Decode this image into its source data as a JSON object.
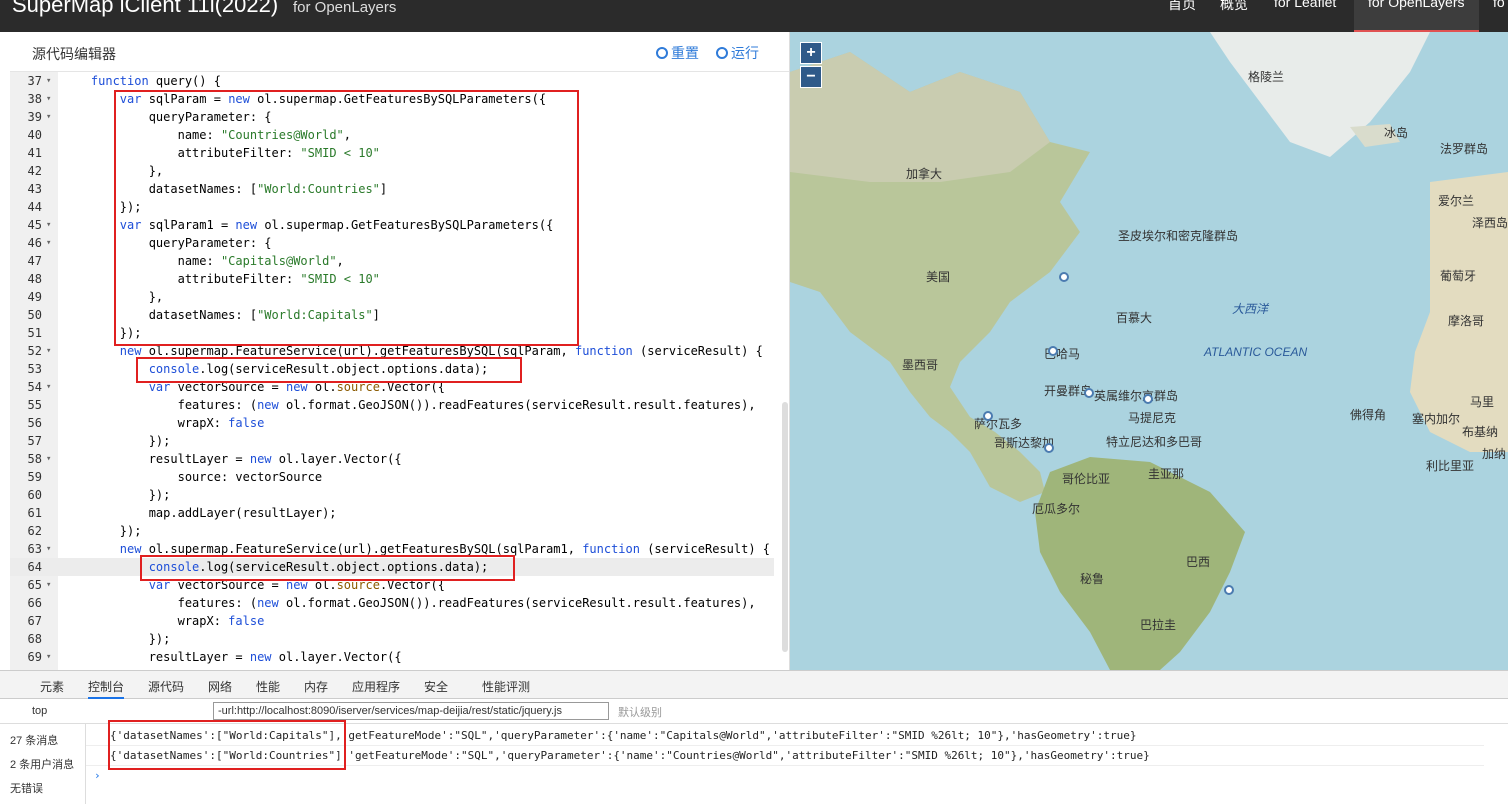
{
  "topbar": {
    "brand": "SuperMap iClient 11i(2022)",
    "subtitle": "for OpenLayers",
    "nav": [
      "首页",
      "概览",
      "for Leaflet",
      "for OpenLayers",
      "fo"
    ]
  },
  "editor": {
    "title": "源代码编辑器",
    "reset_label": "重置",
    "run_label": "运行",
    "lines": [
      {
        "n": "37",
        "fold": true,
        "html": "    <span class='kw'>function</span> query() {"
      },
      {
        "n": "38",
        "fold": true,
        "html": "        <span class='kw'>var</span> sqlParam = <span class='kw'>new</span> ol.supermap.GetFeaturesBySQLParameters({"
      },
      {
        "n": "39",
        "fold": true,
        "html": "            queryParameter: {"
      },
      {
        "n": "40",
        "fold": false,
        "html": "                name: <span class='st'>\"Countries@World\"</span>,"
      },
      {
        "n": "41",
        "fold": false,
        "html": "                attributeFilter: <span class='st'>\"SMID &lt; 10\"</span>"
      },
      {
        "n": "42",
        "fold": false,
        "html": "            },"
      },
      {
        "n": "43",
        "fold": false,
        "html": "            datasetNames: [<span class='st'>\"World:Countries\"</span>]"
      },
      {
        "n": "44",
        "fold": false,
        "html": "        });"
      },
      {
        "n": "45",
        "fold": true,
        "html": "        <span class='kw'>var</span> sqlParam1 = <span class='kw'>new</span> ol.supermap.GetFeaturesBySQLParameters({"
      },
      {
        "n": "46",
        "fold": true,
        "html": "            queryParameter: {"
      },
      {
        "n": "47",
        "fold": false,
        "html": "                name: <span class='st'>\"Capitals@World\"</span>,"
      },
      {
        "n": "48",
        "fold": false,
        "html": "                attributeFilter: <span class='st'>\"SMID &lt; 10\"</span>"
      },
      {
        "n": "49",
        "fold": false,
        "html": "            },"
      },
      {
        "n": "50",
        "fold": false,
        "html": "            datasetNames: [<span class='st'>\"World:Capitals\"</span>]"
      },
      {
        "n": "51",
        "fold": false,
        "html": "        });"
      },
      {
        "n": "52",
        "fold": true,
        "html": "        <span class='kw'>new</span> ol.supermap.FeatureService(url).getFeaturesBySQL(sqlParam, <span class='kw'>function</span> (serviceResult) {"
      },
      {
        "n": "53",
        "fold": false,
        "html": "            <span class='kw'>console</span>.log(serviceResult.object.options.data);"
      },
      {
        "n": "54",
        "fold": true,
        "html": "            <span class='kw'>var</span> vectorSource = <span class='kw'>new</span> ol.<span class='ob'>source</span>.Vector({"
      },
      {
        "n": "55",
        "fold": false,
        "html": "                features: (<span class='kw'>new</span> ol.format.GeoJSON()).readFeatures(serviceResult.result.features),"
      },
      {
        "n": "56",
        "fold": false,
        "html": "                wrapX: <span class='kw'>false</span>"
      },
      {
        "n": "57",
        "fold": false,
        "html": "            });"
      },
      {
        "n": "58",
        "fold": true,
        "html": "            resultLayer = <span class='kw'>new</span> ol.layer.Vector({"
      },
      {
        "n": "59",
        "fold": false,
        "html": "                source: vectorSource"
      },
      {
        "n": "60",
        "fold": false,
        "html": "            });"
      },
      {
        "n": "61",
        "fold": false,
        "html": "            map.addLayer(resultLayer);"
      },
      {
        "n": "62",
        "fold": false,
        "html": "        });"
      },
      {
        "n": "63",
        "fold": true,
        "html": "        <span class='kw'>new</span> ol.supermap.FeatureService(url).getFeaturesBySQL(sqlParam1, <span class='kw'>function</span> (serviceResult) {"
      },
      {
        "n": "64",
        "fold": false,
        "html": "            <span class='kw'>console</span>.log(serviceResult.object.options.data);"
      },
      {
        "n": "65",
        "fold": true,
        "html": "            <span class='kw'>var</span> vectorSource = <span class='kw'>new</span> ol.<span class='ob'>source</span>.Vector({"
      },
      {
        "n": "66",
        "fold": false,
        "html": "                features: (<span class='kw'>new</span> ol.format.GeoJSON()).readFeatures(serviceResult.result.features),"
      },
      {
        "n": "67",
        "fold": false,
        "html": "                wrapX: <span class='kw'>false</span>"
      },
      {
        "n": "68",
        "fold": false,
        "html": "            });"
      },
      {
        "n": "69",
        "fold": true,
        "html": "            resultLayer = <span class='kw'>new</span> ol.layer.Vector({"
      }
    ],
    "highlighted_line": "64"
  },
  "map": {
    "zoom_in": "+",
    "zoom_out": "−",
    "labels": [
      "格陵兰",
      "冰岛",
      "法罗群岛",
      "加拿大",
      "爱尔兰",
      "泽西岛",
      "圣皮埃尔和密克隆群岛",
      "美国",
      "葡萄牙",
      "大西洋",
      "百慕大",
      "摩洛哥",
      "ATLANTIC OCEAN",
      "墨西哥",
      "巴哈马",
      "开曼群岛",
      "英属维尔京群岛",
      "萨尔瓦多",
      "马提尼克",
      "佛得角",
      "塞内加尔",
      "马里",
      "布基纳",
      "哥斯达黎加",
      "特立尼达和多巴哥",
      "加纳",
      "利比里亚",
      "圭亚那",
      "哥伦比亚",
      "厄瓜多尔",
      "巴西",
      "秘鲁",
      "巴拉圭"
    ]
  },
  "devtools": {
    "tabs": [
      "元素",
      "控制台",
      "源代码",
      "网络",
      "性能",
      "内存",
      "应用程序",
      "安全",
      "性能评测"
    ],
    "active_tab": "控制台",
    "context": "top",
    "filter_value": "-url:http://localhost:8090/iserver/services/map-deijia/rest/static/jquery.js",
    "level_label": "默认级别",
    "sidebar": [
      "27 条消息",
      "2 条用户消息",
      "无错误"
    ],
    "console_lines": [
      "{'datasetNames':[\"World:Capitals\"],'getFeatureMode':\"SQL\",'queryParameter':{'name':\"Capitals@World\",'attributeFilter':\"SMID %26lt; 10\"},'hasGeometry':true}",
      "{'datasetNames':[\"World:Countries\"],'getFeatureMode':\"SQL\",'queryParameter':{'name':\"Countries@World\",'attributeFilter':\"SMID %26lt; 10\"},'hasGeometry':true}"
    ],
    "prompt": "›"
  }
}
